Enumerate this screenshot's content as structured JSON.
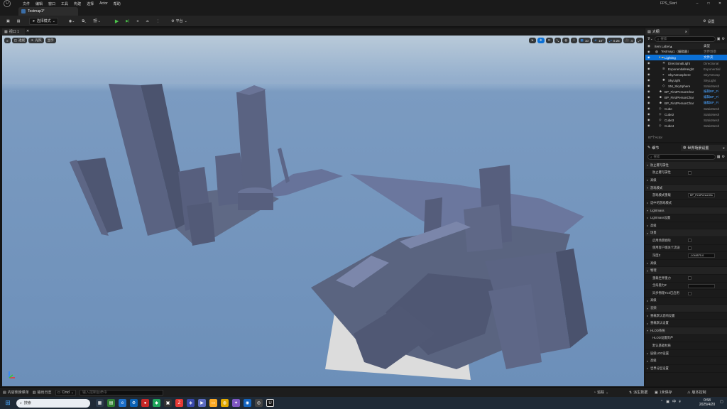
{
  "app": {
    "project_name": "FPS_Start",
    "menu": [
      "文件",
      "编辑",
      "窗口",
      "工具",
      "构建",
      "选择",
      "Actor",
      "帮助"
    ],
    "level_tab": "Testmap1*"
  },
  "toolbar": {
    "mode_label": "选择模式",
    "platform_label": "平台",
    "settings_label": "设置"
  },
  "viewport": {
    "tab_label": "视口 1",
    "perspective_label": "透视",
    "lit_label": "光照",
    "show_label": "显示",
    "grid_snap": "10",
    "rot_snap": "10°",
    "scale_snap": "0.25",
    "camera_speed": "4"
  },
  "outliner": {
    "tab_label": "大纲",
    "search_placeholder": "搜索",
    "col_label": "Item Label",
    "col_type": "类型",
    "sort_arrow": "▲",
    "rows": [
      {
        "label": "Testmap1（编辑器）",
        "type": "世界场景",
        "indent": 0,
        "icon": "world-icon"
      },
      {
        "label": "Lighting",
        "type": "文件夹",
        "indent": 1,
        "icon": "folder-icon",
        "selected": true
      },
      {
        "label": "DirectionalLight",
        "type": "Directional",
        "indent": 2,
        "icon": "light-icon"
      },
      {
        "label": "ExponentialHeight",
        "type": "Exponential",
        "indent": 2,
        "icon": "fog-icon"
      },
      {
        "label": "SkyAtmosphere",
        "type": "SkyAtmosp",
        "indent": 2,
        "icon": "sky-icon"
      },
      {
        "label": "SkyLight",
        "type": "SkyLight",
        "indent": 2,
        "icon": "skylight-icon"
      },
      {
        "label": "SM_SkySphere",
        "type": "StaticMesh",
        "indent": 2,
        "icon": "mesh-icon"
      },
      {
        "label": "BP_FirstPersonChar",
        "type": "编辑BP_Fi",
        "indent": 1,
        "icon": "character-icon",
        "link": true
      },
      {
        "label": "BP_FirstPersonChar",
        "type": "编辑BP_Fi",
        "indent": 1,
        "icon": "character-icon",
        "link": true
      },
      {
        "label": "BP_FirstPersonChar",
        "type": "编辑BP_Fi",
        "indent": 1,
        "icon": "character-icon",
        "link": true
      },
      {
        "label": "Cube",
        "type": "StaticMesh",
        "indent": 1,
        "icon": "mesh-icon"
      },
      {
        "label": "Cube2",
        "type": "StaticMesh",
        "indent": 1,
        "icon": "mesh-icon"
      },
      {
        "label": "Cube3",
        "type": "StaticMesh",
        "indent": 1,
        "icon": "mesh-icon"
      },
      {
        "label": "Cube4",
        "type": "StaticMesh",
        "indent": 1,
        "icon": "mesh-icon"
      }
    ],
    "actor_count": "87个Actor"
  },
  "details": {
    "tab_details": "细节",
    "tab_world": "世界场景设置",
    "search_placeholder": "搜索",
    "rows": [
      {
        "kind": "cat",
        "label": "防止覆写属性"
      },
      {
        "kind": "prop",
        "label": "防止覆写属性",
        "control": "check"
      },
      {
        "kind": "sub",
        "label": "高级"
      },
      {
        "kind": "cat",
        "label": "游戏模式"
      },
      {
        "kind": "prop",
        "label": "游戏模式重载",
        "control": "value",
        "value": "BP_FirstPersonGa"
      },
      {
        "kind": "sub",
        "label": "选中的游戏模式"
      },
      {
        "kind": "cat",
        "label": "Lightmass"
      },
      {
        "kind": "sub",
        "label": "Lightmass设置"
      },
      {
        "kind": "sub",
        "label": "高级"
      },
      {
        "kind": "cat",
        "label": "场景"
      },
      {
        "kind": "prop",
        "label": "启用场景剔除",
        "control": "check"
      },
      {
        "kind": "prop",
        "label": "使用客户端关卡流送",
        "control": "check"
      },
      {
        "kind": "prop",
        "label": "深度Z",
        "control": "value",
        "value": "-1048575.0"
      },
      {
        "kind": "sub",
        "label": "高级"
      },
      {
        "kind": "cat",
        "label": "物理"
      },
      {
        "kind": "prop",
        "label": "重载世界重力",
        "control": "check"
      },
      {
        "kind": "prop",
        "label": "全局重力Z",
        "control": "value",
        "value": ""
      },
      {
        "kind": "prop",
        "label": "异步物理Tick已启用",
        "control": "check"
      },
      {
        "kind": "sub",
        "label": "高级"
      },
      {
        "kind": "cat",
        "label": "音频"
      },
      {
        "kind": "sub",
        "label": "重载默认混响设置"
      },
      {
        "kind": "sub",
        "label": "重载默认设置"
      },
      {
        "kind": "cat",
        "label": "HLOD系统"
      },
      {
        "kind": "prop",
        "label": "HLOD设置资产",
        "control": "none"
      },
      {
        "kind": "prop",
        "label": "默认基础材质",
        "control": "none"
      },
      {
        "kind": "sub",
        "label": "层级LOD设置"
      },
      {
        "kind": "sub",
        "label": "高级"
      },
      {
        "kind": "sub",
        "label": "世界分区设置"
      }
    ],
    "lod_count": "1数组元",
    "material_label": "None"
  },
  "statusbar": {
    "content_drawer": "内容侧滑菜单",
    "output_log": "输出日志",
    "cmd_label": "Cmd",
    "cmd_placeholder": "输入控制台命令",
    "trace": "追踪",
    "derived_data": "派生数据",
    "unsaved": "1未保存",
    "source_control": "版本控制"
  },
  "taskbar": {
    "search_label": "搜索",
    "time": "0:58",
    "date": "2025/4/20",
    "lang": "中"
  }
}
